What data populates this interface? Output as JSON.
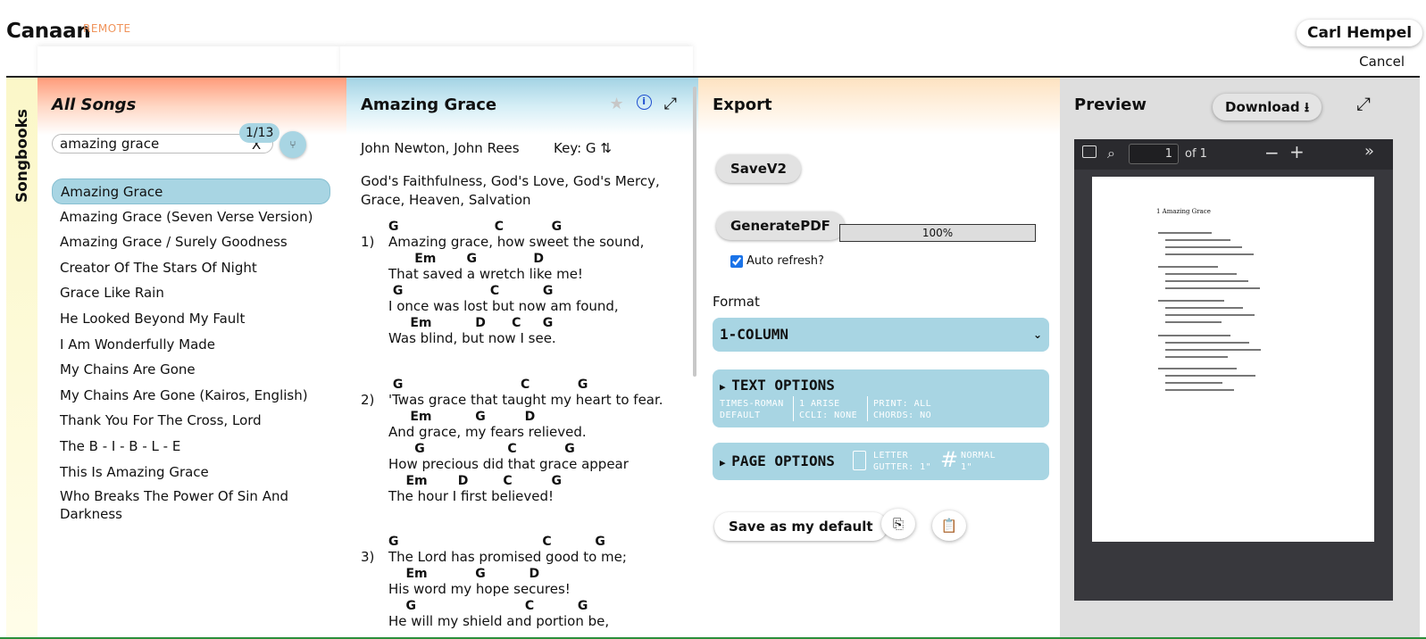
{
  "app": {
    "brand": "Canaan",
    "brand_sub": "REMOTE",
    "user": "Carl Hempel",
    "cancel": "Cancel"
  },
  "songbooks": {
    "label": "Songbooks"
  },
  "list": {
    "title": "All Songs",
    "search_value": "amazing grace",
    "clear": "X",
    "count": "1/13",
    "fork_icon": "fork-icon",
    "songs": [
      "Amazing Grace",
      "Amazing Grace (Seven Verse Version)",
      "Amazing Grace / Surely Goodness",
      "Creator Of The Stars Of Night",
      "Grace Like Rain",
      "He Looked Beyond My Fault",
      "I Am Wonderfully Made",
      "My Chains Are Gone",
      "My Chains Are Gone (Kairos, English)",
      "Thank You For The Cross, Lord",
      "The B - I - B - L - E",
      "This Is Amazing Grace",
      "Who Breaks The Power Of Sin And Darkness"
    ]
  },
  "song": {
    "title": "Amazing Grace",
    "authors": "John Newton, John Rees",
    "key": "Key: G",
    "key_toggle": "⇅",
    "tags": "God's Faithfulness, God's Love, God's Mercy, Grace, Heaven, Salvation",
    "verses": [
      {
        "num": "1)",
        "lines": [
          {
            "c": "G                      C           G",
            "l": "Amazing grace, how sweet the sound,"
          },
          {
            "c": "      Em       G             D",
            "l": "That saved a wretch like me!"
          },
          {
            "c": " G                    C          G",
            "l": "I once was lost but now am found,"
          },
          {
            "c": "     Em          D      C     G",
            "l": "Was blind, but now I see."
          }
        ]
      },
      {
        "num": "2)",
        "lines": [
          {
            "c": " G                           C           G",
            "l": "'Twas grace that taught my heart to fear."
          },
          {
            "c": "     Em          G         D",
            "l": "And grace, my fears relieved."
          },
          {
            "c": "      G                   C           G",
            "l": "How precious did that grace appear"
          },
          {
            "c": "    Em       D        C         G",
            "l": "The hour I first believed!"
          }
        ]
      },
      {
        "num": "3)",
        "lines": [
          {
            "c": "G                                 C          G",
            "l": "The Lord has promised good to me;"
          },
          {
            "c": "    Em           G          D",
            "l": "His word my hope secures!"
          },
          {
            "c": "    G                         C          G",
            "l": "He will my shield and portion be,"
          }
        ]
      }
    ]
  },
  "export": {
    "title": "Export",
    "save_label": "SaveV2",
    "generate_label": "GeneratePDF",
    "progress": "100%",
    "auto_refresh": "Auto refresh?",
    "format_label": "Format",
    "format_value": "1-COLUMN",
    "text_options": {
      "title": "TEXT OPTIONS",
      "font": "TIMES-ROMAN",
      "font_style": "DEFAULT",
      "arise": "1 ARISE",
      "ccli": "CCLI: NONE",
      "print": "PRINT: ALL",
      "chords": "CHORDS: NO"
    },
    "page_options": {
      "title": "PAGE OPTIONS",
      "size": "LETTER",
      "gutter": "GUTTER: 1\"",
      "margins": "NORMAL",
      "margin_val": "1\""
    },
    "save_default": "Save as my default"
  },
  "preview": {
    "title": "Preview",
    "download": "Download ⭳",
    "page": "1",
    "of": "of 1",
    "doc_title": "1  Amazing Grace"
  }
}
